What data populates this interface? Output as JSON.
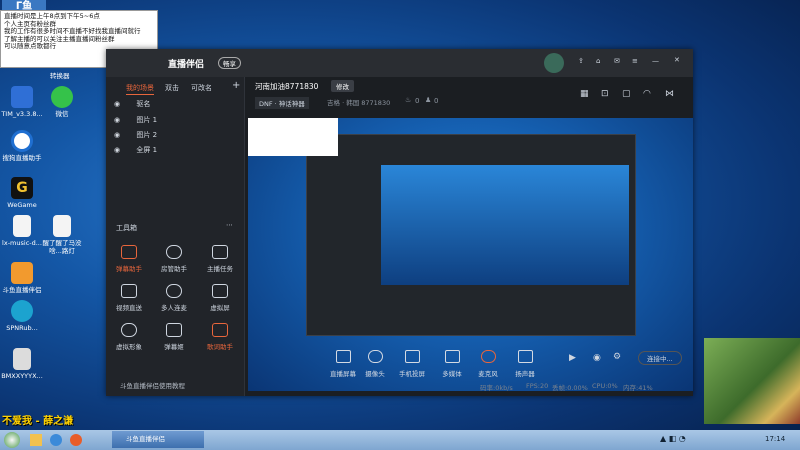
{
  "overlay": {
    "brand_logo_text": "ᒥ鱼",
    "note_lines": [
      "直播时间是上午8点到下午5~6点",
      "个人主页有粉丝群",
      "我的工作有很多时间不直播不好找我直播间就行",
      "了解主播的可以关注主播直播间粉丝群",
      "可以随意点歌都行"
    ],
    "streamer_banner": "不爱我 - 薛之谦"
  },
  "desktop": {
    "icons": [
      {
        "label": "TIM_v3.3.8..."
      },
      {
        "label": "微信"
      },
      {
        "label": "搜狗直播助手"
      },
      {
        "label": "WeGame"
      },
      {
        "label": "lx-music-d..."
      },
      {
        "label": "醒了醒了马没啥...路灯"
      },
      {
        "label": "斗鱼直播伴侣"
      },
      {
        "label": "SPNRub..."
      },
      {
        "label": "BMXXYYYX..."
      }
    ],
    "top_label": "转换器"
  },
  "window": {
    "logo": "直播伴侣",
    "badge": "畅享",
    "left": {
      "tabs": [
        "我的场景",
        "双击",
        "可改名"
      ],
      "add": "+",
      "scenes": [
        "驱名",
        "图片 1",
        "图片 2",
        "全屏 1"
      ],
      "tools_title": "工具箱",
      "tools": [
        {
          "label": "弹幕助手",
          "red": true
        },
        {
          "label": "房管助手",
          "red": false
        },
        {
          "label": "主播任务",
          "red": false
        },
        {
          "label": "视频直送",
          "red": false
        },
        {
          "label": "多人连麦",
          "red": false
        },
        {
          "label": "虚拟屏",
          "red": false
        },
        {
          "label": "虚拟形象",
          "red": false
        },
        {
          "label": "弹幕姬",
          "red": false
        },
        {
          "label": "歌词助手",
          "red": true
        }
      ],
      "footer": "斗鱼直播伴侣使用教程"
    },
    "room": {
      "title": "河南加油8771830",
      "edit": "修改",
      "category": "DNF · 神话神器",
      "meta": "吉格 · 韩国  8771830",
      "hot": "0",
      "fans": "0"
    },
    "bottom": {
      "tools": [
        "直播屏幕",
        "摄像头",
        "手机投屏",
        "多媒体",
        "麦克风",
        "扬声器"
      ],
      "live_btn": "连接中...",
      "stats": [
        "码率:0kb/s",
        "FPS:20",
        "丢帧:0.00%",
        "CPU:0%",
        "内存:41%"
      ]
    },
    "colors": {
      "accent": "#e8663c",
      "bg": "#1e2125",
      "green": "#3eb36a"
    }
  },
  "taskbar": {
    "items": [
      "斗鱼直播伴侣"
    ],
    "clock": "17:14"
  }
}
